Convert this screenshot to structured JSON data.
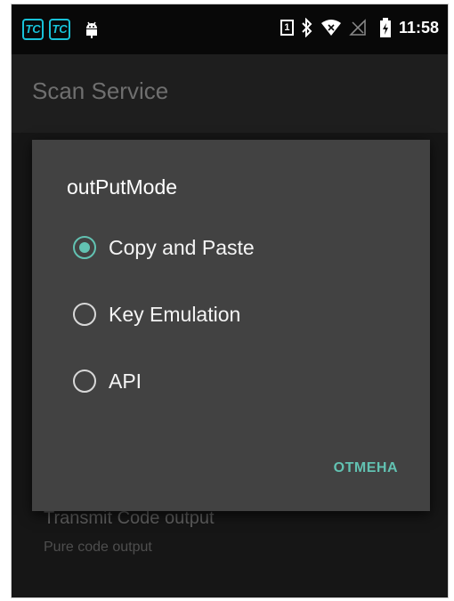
{
  "status_bar": {
    "left_icons": [
      "tc-app-icon",
      "tc-app-icon",
      "android-debug-icon"
    ],
    "tc_icon_text": "TC",
    "sim_slot": "1",
    "right_icons": [
      "sim-icon",
      "bluetooth-icon",
      "wifi-icon",
      "no-signal-icon",
      "battery-charging-icon"
    ],
    "time": "11:58"
  },
  "app_bar": {
    "title": "Scan Service"
  },
  "background_pref": {
    "title": "Transmit Code output",
    "summary": "Pure code output"
  },
  "dialog": {
    "title": "outPutMode",
    "options": [
      {
        "label": "Copy and Paste",
        "checked": true
      },
      {
        "label": "Key Emulation",
        "checked": false
      },
      {
        "label": "API",
        "checked": false
      }
    ],
    "cancel_label": "ОТМЕНА"
  },
  "colors": {
    "accent": "#62c2b2",
    "dialog_bg": "#424242",
    "screen_bg": "#161616",
    "tc_icon": "#18c2d8"
  }
}
